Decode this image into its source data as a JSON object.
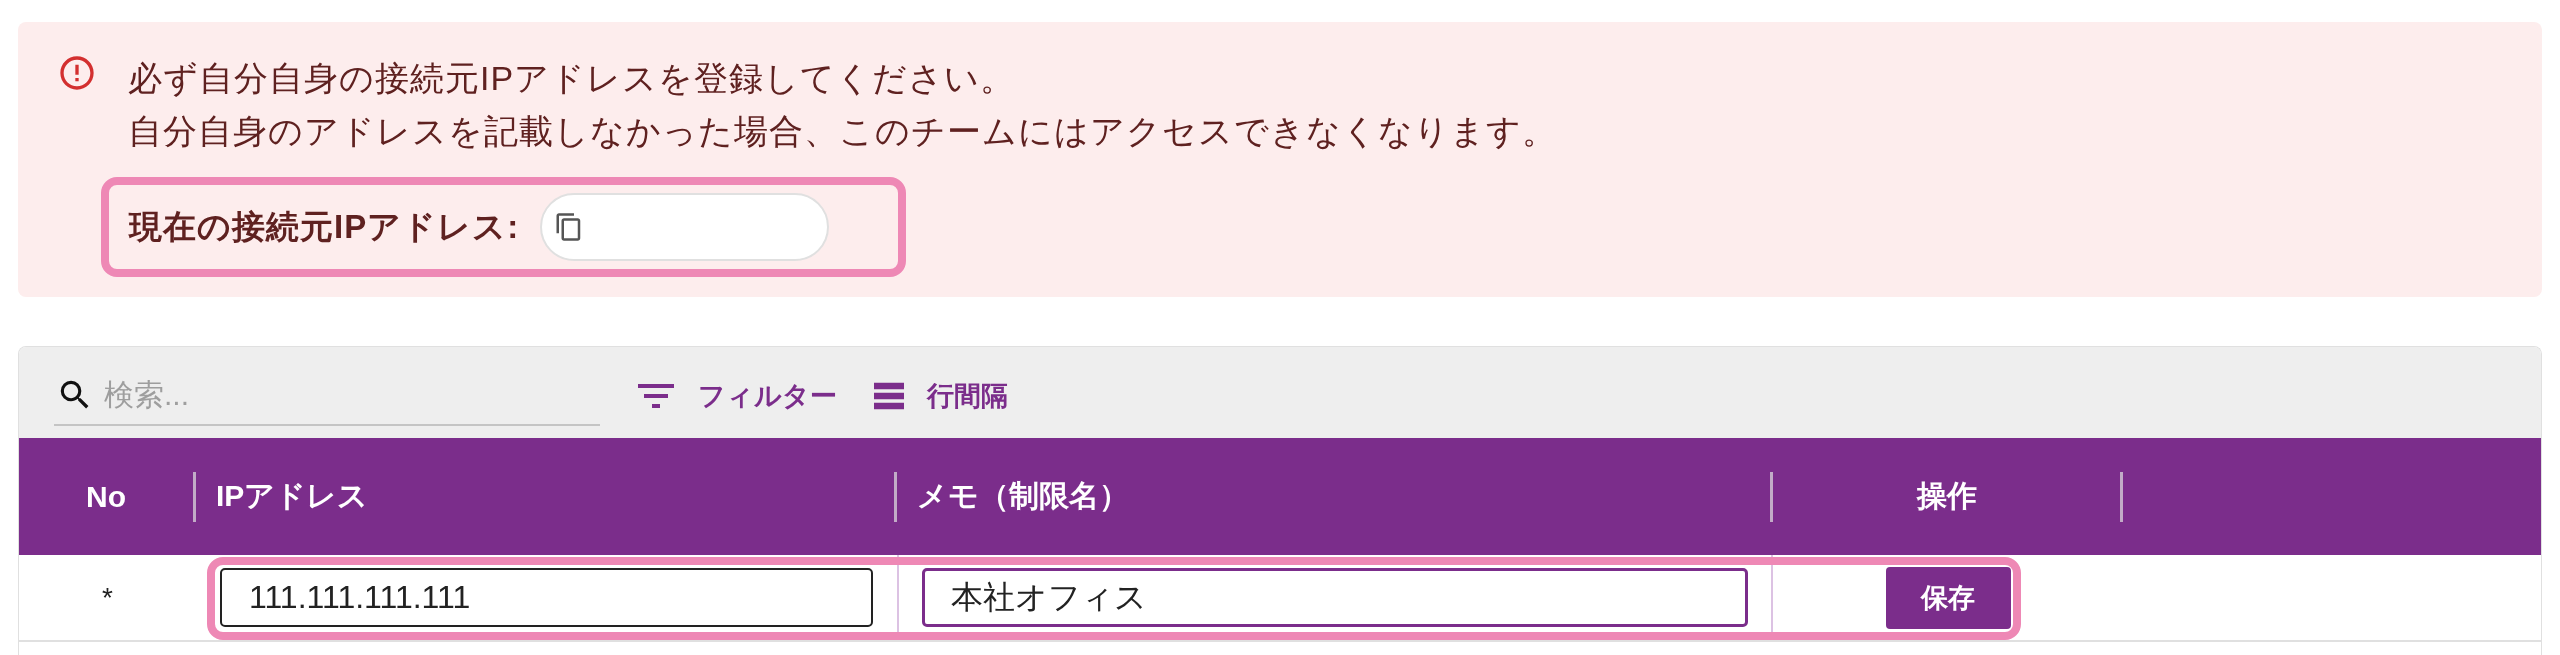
{
  "alert": {
    "lines": [
      "必ず自分自身の接続元IPアドレスを登録してください。",
      "自分自身のアドレスを記載しなかった場合、このチームにはアクセスできなくなります。"
    ],
    "current_ip": {
      "label": "現在の接続元IPアドレス:",
      "highlighted": true
    }
  },
  "toolbar": {
    "search": {
      "placeholder": "検索..."
    },
    "buttons": [
      {
        "kind": "filter",
        "label": "フィルター"
      },
      {
        "kind": "density",
        "label": "行間隔"
      }
    ]
  },
  "table": {
    "columns": [
      "No",
      "IPアドレス",
      "メモ（制限名）",
      "操作"
    ],
    "rows": [
      {
        "no": "*",
        "ip_address": {
          "value": "111.111.111.111",
          "focused": false
        },
        "memo": {
          "value": "本社オフィス",
          "focused": true
        },
        "action": "保存",
        "highlighted": true
      }
    ]
  }
}
